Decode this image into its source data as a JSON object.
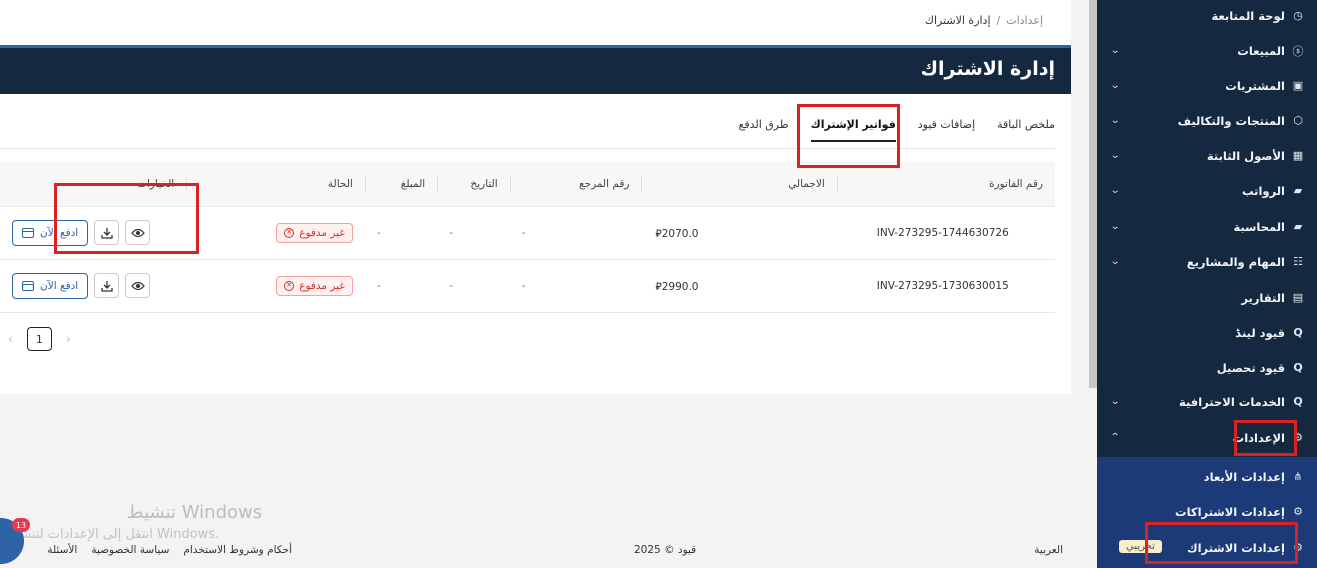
{
  "breadcrumb": {
    "parent": "إعدادات",
    "separator": "/",
    "current": "إدارة الاشتراك"
  },
  "page_title": "إدارة الاشتراك",
  "tabs": [
    {
      "label": "ملخص الباقة",
      "active": false
    },
    {
      "label": "إضافات قيود",
      "active": false
    },
    {
      "label": "فواتير الإشتراك",
      "active": true
    },
    {
      "label": "طرق الدفع",
      "active": false
    }
  ],
  "table": {
    "headers": [
      "رقم الفاتورة",
      "الاجمالي",
      "رقم المرجع",
      "التاريخ",
      "المبلغ",
      "الحالة",
      "الخيارات"
    ],
    "currency_symbol": "⃁",
    "rows": [
      {
        "invoice": "INV-273295-1744630726",
        "total": "2070.0",
        "ref": "-",
        "date": "-",
        "amount": "-",
        "status": "غير مدفوع",
        "pay_label": "ادفع الآن"
      },
      {
        "invoice": "INV-273295-1730630015",
        "total": "2990.0",
        "ref": "-",
        "date": "-",
        "amount": "-",
        "status": "غير مدفوع",
        "pay_label": "ادفع الآن"
      }
    ]
  },
  "pagination": {
    "current": "1",
    "prev": "‹",
    "next": "›"
  },
  "sidebar": {
    "items": [
      {
        "label": "لوحة المتابعة",
        "icon": "dashboard-icon",
        "chevron": false
      },
      {
        "label": "المبيعات",
        "icon": "sales-icon",
        "chevron": true
      },
      {
        "label": "المشتريات",
        "icon": "purchases-icon",
        "chevron": true
      },
      {
        "label": "المنتجات والتكاليف",
        "icon": "box-icon",
        "chevron": true
      },
      {
        "label": "الأصول الثابتة",
        "icon": "grid-icon",
        "chevron": true
      },
      {
        "label": "الرواتب",
        "icon": "folder-icon",
        "chevron": true
      },
      {
        "label": "المحاسبة",
        "icon": "folder-icon",
        "chevron": true
      },
      {
        "label": "المهام والمشاريع",
        "icon": "list-icon",
        "chevron": true
      },
      {
        "label": "التقارير",
        "icon": "report-icon",
        "chevron": false
      },
      {
        "label": "قيود لينڈ",
        "icon": "search-icon",
        "chevron": false
      },
      {
        "label": "قيود تحصيل",
        "icon": "search-icon",
        "chevron": false
      },
      {
        "label": "الخدمات الاحترافية",
        "icon": "search-icon",
        "chevron": true
      },
      {
        "label": "الإعدادات",
        "icon": "gear-icon",
        "chevron": true,
        "expanded": true
      }
    ],
    "sub_items": [
      {
        "label": "إعدادات الأبعاد",
        "icon": "hierarchy-icon"
      },
      {
        "label": "إعدادات الاشتراكات",
        "icon": "gear-icon"
      },
      {
        "label": "إعدادات الاشتراك",
        "icon": "gear-icon",
        "active": true
      }
    ],
    "new_badge": "تجريبي"
  },
  "footer": {
    "language": "العربية",
    "copyright": "قيود © 2025",
    "links": [
      "أحكام وشروط الاستخدام",
      "سياسة الخصوصية",
      "الأسئلة"
    ]
  },
  "watermark": {
    "title": "تنشيط Windows",
    "subtitle": "انتقل إلى الإعدادات لتنشيط Windows."
  },
  "chat_badge": "13",
  "colors": {
    "sidebar": "#14293f",
    "sub_menu": "#1c3a78",
    "accent": "#2c64a6",
    "danger": "#d32f2f",
    "highlight": "#d92323"
  }
}
